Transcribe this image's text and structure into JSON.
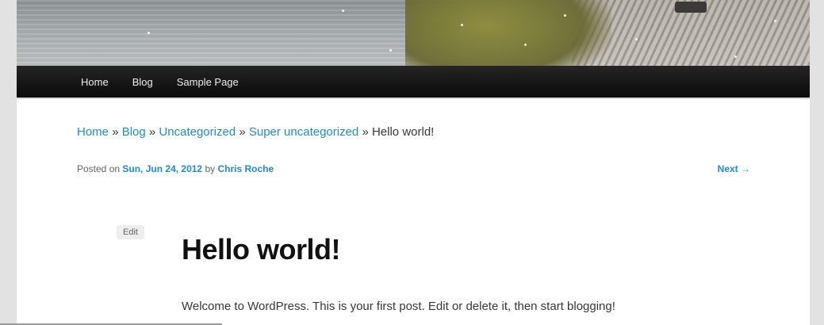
{
  "nav": {
    "items": [
      {
        "label": "Home"
      },
      {
        "label": "Blog"
      },
      {
        "label": "Sample Page"
      }
    ]
  },
  "breadcrumb": {
    "items": [
      "Home",
      "Blog",
      "Uncategorized",
      "Super uncategorized"
    ],
    "separator": "»",
    "current": "Hello world!"
  },
  "meta": {
    "posted_on": "Posted on",
    "date": "Sun, Jun 24, 2012",
    "by": "by",
    "author": "Chris Roche"
  },
  "next_link": "Next →",
  "edit_label": "Edit",
  "post": {
    "title": "Hello world!",
    "content": "Welcome to WordPress. This is your first post. Edit or delete it, then start blogging!"
  },
  "colors": {
    "link": "#1b8be0",
    "nav_bg": "#0a0a0a",
    "page_bg": "#e2e2e2"
  }
}
